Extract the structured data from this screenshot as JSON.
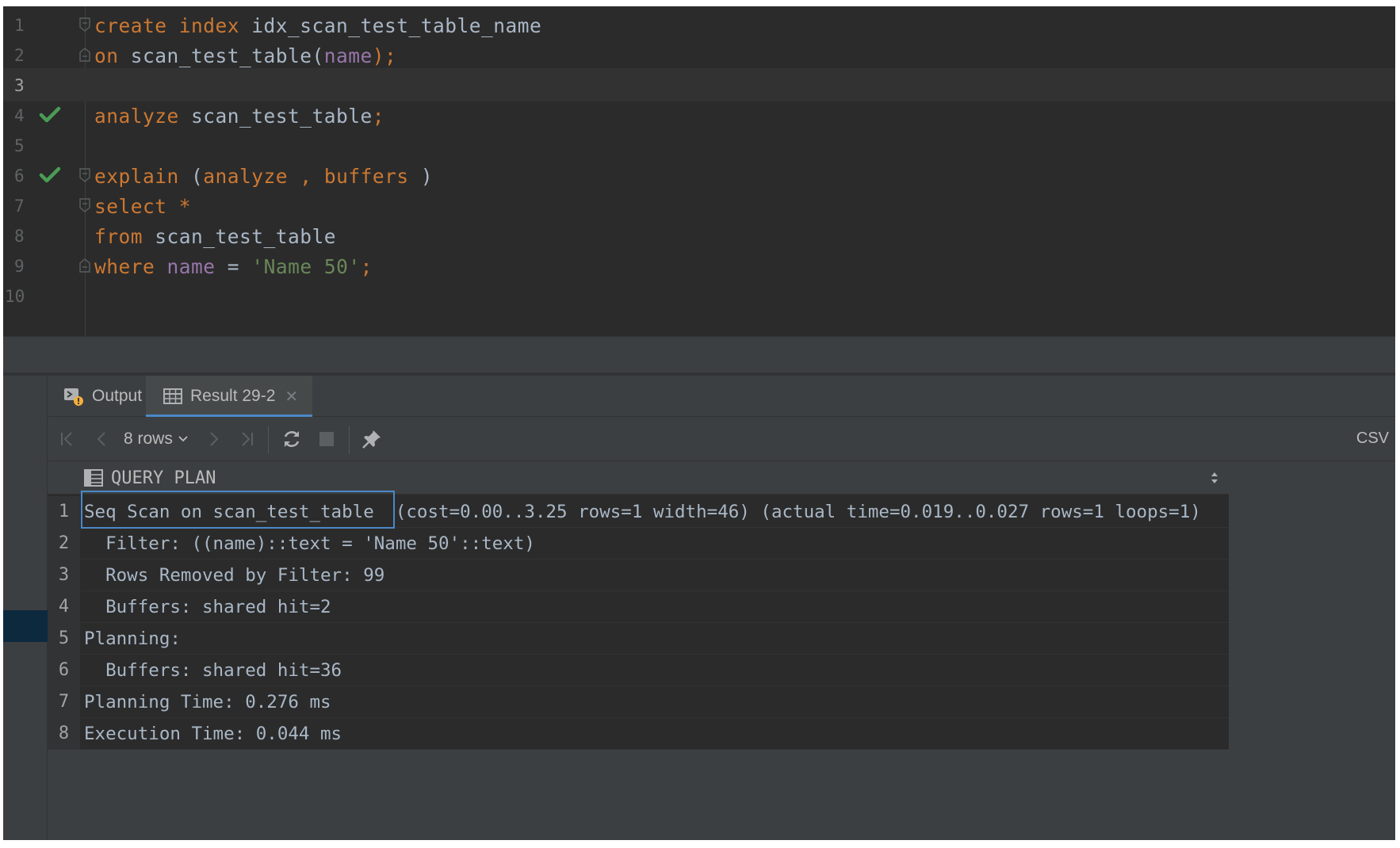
{
  "editor": {
    "lines": [
      {
        "num": "1",
        "tokens": [
          {
            "t": "create",
            "c": "kw"
          },
          {
            "t": " "
          },
          {
            "t": "index",
            "c": "kw"
          },
          {
            "t": " idx_scan_test_table_name",
            "c": "ident"
          }
        ]
      },
      {
        "num": "2",
        "tokens": [
          {
            "t": "on",
            "c": "kw"
          },
          {
            "t": " scan_test_table(",
            "c": "ident"
          },
          {
            "t": "name",
            "c": "col"
          },
          {
            "t": ");",
            "c": "kwp"
          }
        ]
      },
      {
        "num": "3",
        "tokens": []
      },
      {
        "num": "4",
        "tokens": [
          {
            "t": "analyze",
            "c": "kw"
          },
          {
            "t": " scan_test_table",
            "c": "ident"
          },
          {
            "t": ";",
            "c": "kwp"
          }
        ]
      },
      {
        "num": "5",
        "tokens": []
      },
      {
        "num": "6",
        "tokens": [
          {
            "t": "explain",
            "c": "kw"
          },
          {
            "t": " (",
            "c": "ident"
          },
          {
            "t": "analyze",
            "c": "kw"
          },
          {
            "t": " , ",
            "c": "kwp"
          },
          {
            "t": "buffers",
            "c": "kw"
          },
          {
            "t": " )",
            "c": "ident"
          }
        ]
      },
      {
        "num": "7",
        "tokens": [
          {
            "t": "select",
            "c": "kw"
          },
          {
            "t": " "
          },
          {
            "t": "*",
            "c": "kw"
          }
        ]
      },
      {
        "num": "8",
        "tokens": [
          {
            "t": "from",
            "c": "kw"
          },
          {
            "t": " scan_test_table",
            "c": "ident"
          }
        ]
      },
      {
        "num": "9",
        "tokens": [
          {
            "t": "where",
            "c": "kw"
          },
          {
            "t": " "
          },
          {
            "t": "name",
            "c": "col"
          },
          {
            "t": " = ",
            "c": "ident"
          },
          {
            "t": "'Name 50'",
            "c": "str"
          },
          {
            "t": ";",
            "c": "kwp"
          }
        ]
      },
      {
        "num": "10",
        "tokens": []
      }
    ]
  },
  "tabs": {
    "output_label": "Output",
    "result_label": "Result 29-2"
  },
  "toolbar": {
    "rows_label": "8 rows",
    "csv_label": "CSV"
  },
  "grid": {
    "column_header": "QUERY PLAN",
    "rows": [
      {
        "num": "1",
        "text": "Seq Scan on scan_test_table  (cost=0.00..3.25 rows=1 width=46) (actual time=0.019..0.027 rows=1 loops=1)"
      },
      {
        "num": "2",
        "text": "  Filter: ((name)::text = 'Name 50'::text)"
      },
      {
        "num": "3",
        "text": "  Rows Removed by Filter: 99"
      },
      {
        "num": "4",
        "text": "  Buffers: shared hit=2"
      },
      {
        "num": "5",
        "text": "Planning:"
      },
      {
        "num": "6",
        "text": "  Buffers: shared hit=36"
      },
      {
        "num": "7",
        "text": "Planning Time: 0.276 ms"
      },
      {
        "num": "8",
        "text": "Execution Time: 0.044 ms"
      }
    ]
  },
  "colors": {
    "keyword": "#cc7832",
    "identifier": "#a9b7c6",
    "column": "#9876aa",
    "string": "#6a8759",
    "check": "#499c54",
    "highlight": "#4a88c7"
  }
}
